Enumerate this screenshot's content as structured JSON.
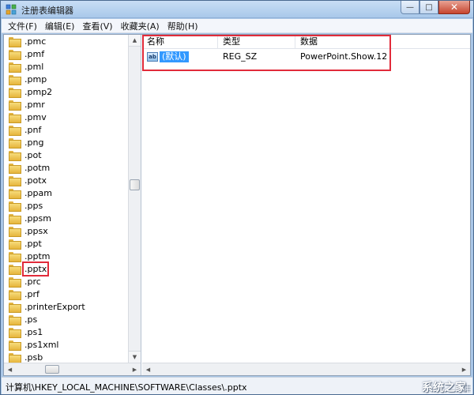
{
  "window": {
    "title": "注册表编辑器",
    "controls": {
      "minimize": "—",
      "maximize": "□",
      "close": "✕"
    }
  },
  "menu": {
    "items": [
      "文件(F)",
      "编辑(E)",
      "查看(V)",
      "收藏夹(A)",
      "帮助(H)"
    ]
  },
  "tree": {
    "items": [
      ".pmc",
      ".pmf",
      ".pml",
      ".pmp",
      ".pmp2",
      ".pmr",
      ".pmv",
      ".pnf",
      ".png",
      ".pot",
      ".potm",
      ".potx",
      ".ppam",
      ".pps",
      ".ppsm",
      ".ppsx",
      ".ppt",
      ".pptm",
      ".pptx",
      ".prc",
      ".prf",
      ".printerExport",
      ".ps",
      ".ps1",
      ".ps1xml",
      ".psb"
    ],
    "selected": ".pptx"
  },
  "values": {
    "columns": {
      "name": "名称",
      "type": "类型",
      "data": "数据"
    },
    "rows": [
      {
        "name": "(默认)",
        "type": "REG_SZ",
        "data": "PowerPoint.Show.12"
      }
    ]
  },
  "status": {
    "path": "计算机\\HKEY_LOCAL_MACHINE\\SOFTWARE\\Classes\\.pptx",
    "watermark": "系统之家"
  },
  "colors": {
    "highlight": "#e12b3a",
    "selection": "#3399ff",
    "titlebar": "#a9c8ea"
  },
  "icons": {
    "app": "regedit-icon",
    "folder": "folder-icon",
    "string_value": "ab-string-icon"
  }
}
